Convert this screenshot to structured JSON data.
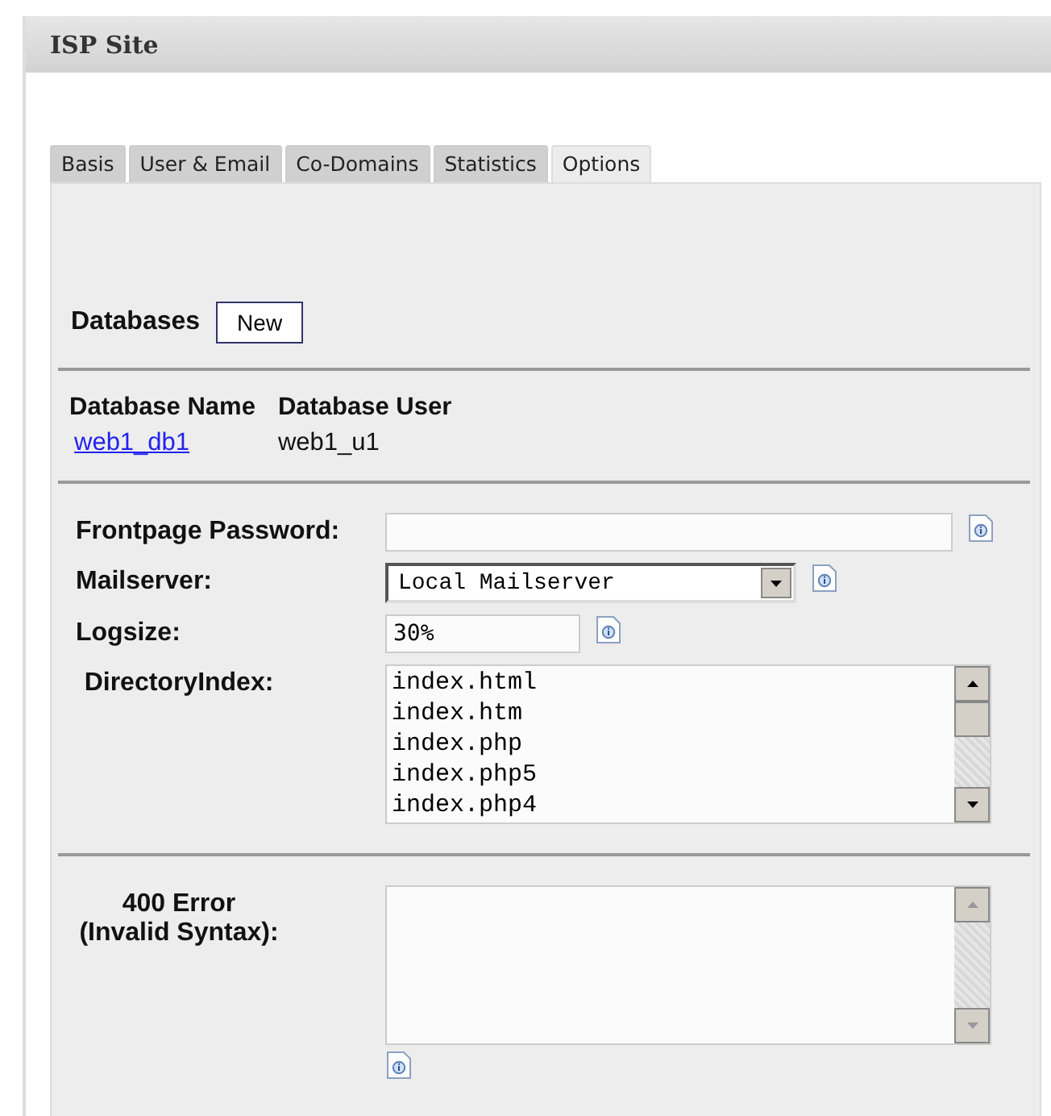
{
  "panel": {
    "title": "ISP Site"
  },
  "tabs": [
    {
      "label": "Basis",
      "selected": false
    },
    {
      "label": "User & Email",
      "selected": false
    },
    {
      "label": "Co-Domains",
      "selected": false
    },
    {
      "label": "Statistics",
      "selected": false
    },
    {
      "label": "Options",
      "selected": true
    }
  ],
  "databases": {
    "title": "Databases",
    "new_button": "New",
    "columns": [
      "Database Name",
      "Database User"
    ],
    "rows": [
      {
        "name": "web1_db1",
        "user": "web1_u1"
      }
    ]
  },
  "field_groups": [
    [
      {
        "kind": "text",
        "label": "Frontpage Password:",
        "help_icon": true
      },
      {
        "kind": "select",
        "label": "Mailserver:",
        "value": "Local Mailserver",
        "help_icon": true
      },
      {
        "kind": "short",
        "label": "Logsize:",
        "value": "30%",
        "help_icon": true
      },
      {
        "kind": "textarea",
        "label": "DirectoryIndex:",
        "value": "index.html\nindex.htm\nindex.php\nindex.php5\nindex.php4",
        "help_icon": false
      }
    ],
    [
      {
        "kind": "textarea",
        "label": "400 Error\n(Invalid Syntax):",
        "help_icon": true
      }
    ]
  ]
}
